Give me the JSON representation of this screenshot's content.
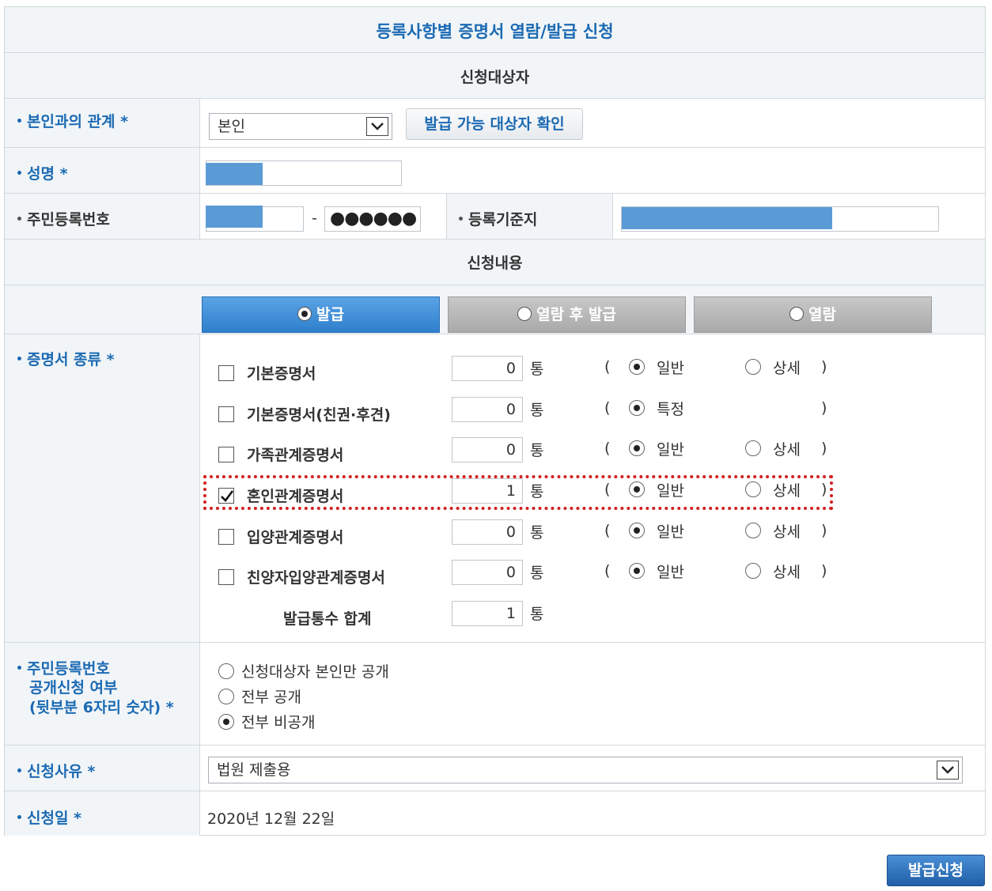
{
  "page_title": "등록사항별 증명서 열람/발급 신청",
  "section_target": "신청대상자",
  "section_content": "신청내용",
  "relation": {
    "label": "본인과의 관계 *",
    "selected": "본인",
    "check_button": "발급 가능 대상자 확인"
  },
  "name": {
    "label": "성명 *"
  },
  "rrn": {
    "label": "주민등록번호",
    "separator": "-",
    "masked": "●●●●●●",
    "address_label": "등록기준지"
  },
  "tabs": [
    {
      "label": "발급",
      "active": true
    },
    {
      "label": "열람 후 발급",
      "active": false
    },
    {
      "label": "열람",
      "active": false
    }
  ],
  "cert": {
    "label": "증명서 종류 *",
    "unit": "통",
    "open_paren": "(",
    "close_paren": ")",
    "items": [
      {
        "name": "기본증명서",
        "checked": false,
        "qty": "0",
        "opt1": "일반",
        "opt2": "상세",
        "selected": "opt1"
      },
      {
        "name": "기본증명서(친권·후견)",
        "checked": false,
        "qty": "0",
        "opt1": "특정",
        "opt2": "",
        "selected": "opt1"
      },
      {
        "name": "가족관계증명서",
        "checked": false,
        "qty": "0",
        "opt1": "일반",
        "opt2": "상세",
        "selected": "opt1"
      },
      {
        "name": "혼인관계증명서",
        "checked": true,
        "qty": "1",
        "opt1": "일반",
        "opt2": "상세",
        "selected": "opt1"
      },
      {
        "name": "입양관계증명서",
        "checked": false,
        "qty": "0",
        "opt1": "일반",
        "opt2": "상세",
        "selected": "opt1"
      },
      {
        "name": "친양자입양관계증명서",
        "checked": false,
        "qty": "0",
        "opt1": "일반",
        "opt2": "상세",
        "selected": "opt1"
      }
    ],
    "total_label": "발급통수 합계",
    "total_qty": "1"
  },
  "disclosure": {
    "label_line1": "주민등록번호",
    "label_line2": "공개신청 여부",
    "label_line3": "(뒷부분 6자리 숫자) *",
    "options": [
      {
        "label": "신청대상자 본인만 공개",
        "selected": false
      },
      {
        "label": "전부 공개",
        "selected": false
      },
      {
        "label": "전부 비공개",
        "selected": true
      }
    ]
  },
  "reason": {
    "label": "신청사유 *",
    "selected": "법원 제출용"
  },
  "date": {
    "label": "신청일 *",
    "value": "2020년 12월 22일"
  },
  "submit_label": "발급신청",
  "colors": {
    "accent": "#1b6ab3",
    "tab_active": "#3c8ad6",
    "highlight": "#d21f1f"
  }
}
